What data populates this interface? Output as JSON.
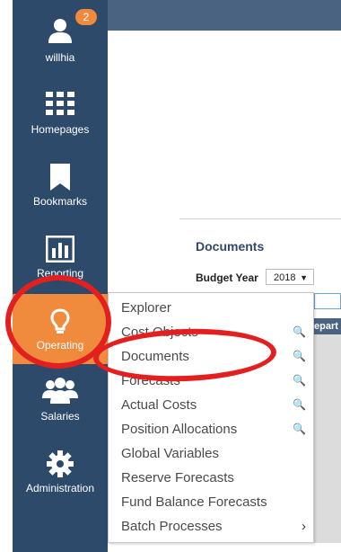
{
  "user": {
    "name": "willhia",
    "notification_count": "2"
  },
  "sidebar": {
    "items": [
      {
        "label": "Homepages",
        "icon": "grid-icon"
      },
      {
        "label": "Bookmarks",
        "icon": "bookmark-icon"
      },
      {
        "label": "Reporting",
        "icon": "bar-chart-icon"
      },
      {
        "label": "Operating",
        "icon": "lightbulb-icon"
      },
      {
        "label": "Salaries",
        "icon": "people-icon"
      },
      {
        "label": "Administration",
        "icon": "gear-icon"
      }
    ]
  },
  "main": {
    "title": "Documents",
    "budget_year_label": "Budget Year",
    "budget_year_value": "2018",
    "table_header_fragment": "epart"
  },
  "operating_menu": {
    "items": [
      {
        "label": "Explorer"
      },
      {
        "label": "Cost Objects"
      },
      {
        "label": "Documents"
      },
      {
        "label": "Forecasts"
      },
      {
        "label": "Actual Costs"
      },
      {
        "label": "Position Allocations"
      },
      {
        "label": "Global Variables"
      },
      {
        "label": "Reserve Forecasts"
      },
      {
        "label": "Fund Balance Forecasts"
      },
      {
        "label": "Batch Processes"
      }
    ]
  },
  "colors": {
    "sidebar": "#2d4a6b",
    "accent": "#f08a3c",
    "annotation": "#e41f1f"
  }
}
